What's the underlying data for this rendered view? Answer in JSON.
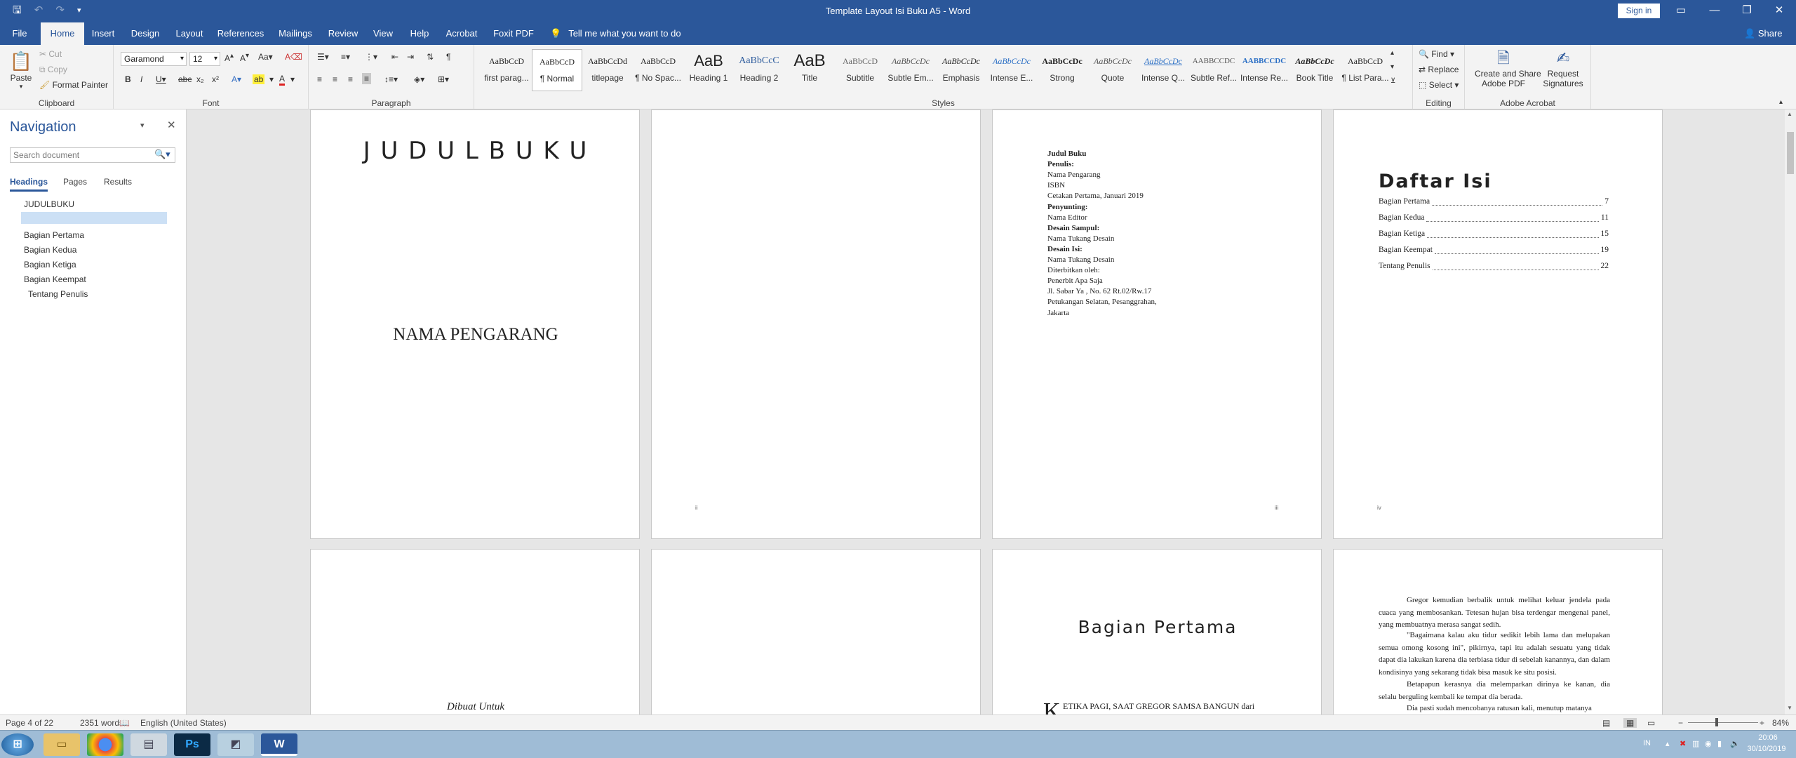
{
  "window": {
    "title": "Template Layout Isi Buku A5  -  Word",
    "sign_in": "Sign in",
    "share": "Share",
    "colors": {
      "brand": "#2b579a",
      "ribbon_bg": "#f3f3f3",
      "canvas_bg": "#e6e6e6"
    }
  },
  "tabs": [
    "File",
    "Home",
    "Insert",
    "Design",
    "Layout",
    "References",
    "Mailings",
    "Review",
    "View",
    "Help",
    "Acrobat",
    "Foxit PDF"
  ],
  "active_tab": "Home",
  "tell_me": "Tell me what you want to do",
  "ribbon": {
    "clipboard": {
      "paste": "Paste",
      "cut": "Cut",
      "copy": "Copy",
      "format_painter": "Format Painter",
      "label": "Clipboard"
    },
    "font": {
      "name": "Garamond",
      "size": "12",
      "label": "Font"
    },
    "paragraph": {
      "label": "Paragraph"
    },
    "styles": {
      "label": "Styles",
      "items": [
        {
          "preview": "AaBbCcD",
          "name": "first parag..."
        },
        {
          "preview": "AaBbCcD",
          "name": "¶ Normal"
        },
        {
          "preview": "AaBbCcDd",
          "name": "titlepage"
        },
        {
          "preview": "AaBbCcD",
          "name": "¶ No Spac..."
        },
        {
          "preview": "AaB",
          "name": "Heading 1"
        },
        {
          "preview": "AaBbCcC",
          "name": "Heading 2"
        },
        {
          "preview": "AaB",
          "name": "Title"
        },
        {
          "preview": "AaBbCcD",
          "name": "Subtitle"
        },
        {
          "preview": "AaBbCcDc",
          "name": "Subtle Em..."
        },
        {
          "preview": "AaBbCcDc",
          "name": "Emphasis"
        },
        {
          "preview": "AaBbCcDc",
          "name": "Intense E..."
        },
        {
          "preview": "AaBbCcDc",
          "name": "Strong"
        },
        {
          "preview": "AaBbCcDc",
          "name": "Quote"
        },
        {
          "preview": "AaBbCcDc",
          "name": "Intense Q..."
        },
        {
          "preview": "AABBCCDC",
          "name": "Subtle Ref..."
        },
        {
          "preview": "AABBCCDC",
          "name": "Intense Re..."
        },
        {
          "preview": "AaBbCcDc",
          "name": "Book Title"
        },
        {
          "preview": "AaBbCcD",
          "name": "¶ List Para..."
        }
      ]
    },
    "editing": {
      "find": "Find",
      "replace": "Replace",
      "select": "Select",
      "label": "Editing"
    },
    "acrobat": {
      "create_share": "Create and Share",
      "adobe_pdf": "Adobe PDF",
      "request": "Request",
      "signatures": "Signatures",
      "label": "Adobe Acrobat"
    }
  },
  "navigation": {
    "title": "Navigation",
    "search_placeholder": "Search document",
    "tabs": [
      "Headings",
      "Pages",
      "Results"
    ],
    "headings": [
      "JUDULBUKU",
      "",
      "Bagian Pertama",
      "Bagian Kedua",
      "Bagian Ketiga",
      "Bagian Keempat",
      "Tentang Penulis"
    ]
  },
  "pages": {
    "p1": {
      "title": "J U D U L B U K U",
      "author": "NAMA PENGARANG"
    },
    "p2": {
      "page_mark": "ii"
    },
    "p3": {
      "lines": [
        {
          "t": "Judul Buku",
          "b": true
        },
        {
          "t": "Penulis:",
          "b": true
        },
        {
          "t": "Nama Pengarang",
          "b": false
        },
        {
          "t": "ISBN",
          "b": false
        },
        {
          "t": "Cetakan Pertama, Januari 2019",
          "b": false
        },
        {
          "t": "Penyunting:",
          "b": true
        },
        {
          "t": "Nama Editor",
          "b": false
        },
        {
          "t": "Desain Sampul:",
          "b": true
        },
        {
          "t": "Nama Tukang Desain",
          "b": false
        },
        {
          "t": "Desain Isi:",
          "b": true
        },
        {
          "t": "Nama Tukang Desain",
          "b": false
        },
        {
          "t": "Diterbitkan oleh:",
          "b": false
        },
        {
          "t": "Penerbit Apa Saja",
          "b": false
        },
        {
          "t": "Jl. Sabar Ya , No. 62 Rt.02/Rw.17",
          "b": false
        },
        {
          "t": "Petukangan Selatan, Pesanggrahan,",
          "b": false
        },
        {
          "t": "Jakarta",
          "b": false
        }
      ],
      "page_mark": "iii"
    },
    "p4": {
      "title": "Daftar Isi",
      "toc": [
        {
          "label": "Bagian Pertama",
          "page": "7"
        },
        {
          "label": "Bagian Kedua",
          "page": "11"
        },
        {
          "label": "Bagian Ketiga",
          "page": "15"
        },
        {
          "label": "Bagian Keempat",
          "page": "19"
        },
        {
          "label": "Tentang Penulis",
          "page": "22"
        }
      ],
      "page_mark": "iv"
    },
    "p5": {
      "dedication": "Dibuat Untuk"
    },
    "p7": {
      "title": "Bagian Pertama",
      "dropcap": "K",
      "first_line": "ETIKA PAGI, SAAT GREGOR SAMSA BANGUN dari"
    },
    "p8": {
      "paragraphs": [
        "Gregor kemudian berbalik untuk melihat keluar jendela pada cuaca yang membosankan. Tetesan hujan bisa terdengar mengenai panel, yang membuatnya merasa sangat sedih.",
        "\"Bagaimana kalau aku tidur sedikit lebih lama dan melupakan semua omong kosong ini\", pikirnya, tapi itu adalah sesuatu yang tidak dapat dia lakukan karena dia terbiasa tidur di sebelah kanannya, dan dalam kondisinya yang sekarang tidak bisa masuk ke situ posisi.",
        "Betapapun kerasnya dia melemparkan dirinya ke kanan, dia selalu berguling kembali ke tempat dia berada.",
        "Dia pasti sudah mencobanya ratusan kali, menutup matanya"
      ]
    }
  },
  "status": {
    "page": "Page 4 of 22",
    "words": "2351 words",
    "language": "English (United States)",
    "zoom": "84%"
  },
  "taskbar": {
    "lang": "IN",
    "time": "20:06",
    "date": "30/10/2019"
  }
}
